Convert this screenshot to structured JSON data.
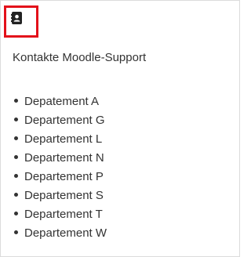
{
  "block": {
    "icon": "address-book-icon",
    "title": "Kontakte Moodle-Support",
    "highlight_color": "#e3101a",
    "departments": [
      {
        "label": "Depatement A"
      },
      {
        "label": "Departement G"
      },
      {
        "label": "Departement L"
      },
      {
        "label": "Departement N"
      },
      {
        "label": "Departement P"
      },
      {
        "label": "Departement S"
      },
      {
        "label": "Departement T"
      },
      {
        "label": "Departement W"
      }
    ]
  }
}
